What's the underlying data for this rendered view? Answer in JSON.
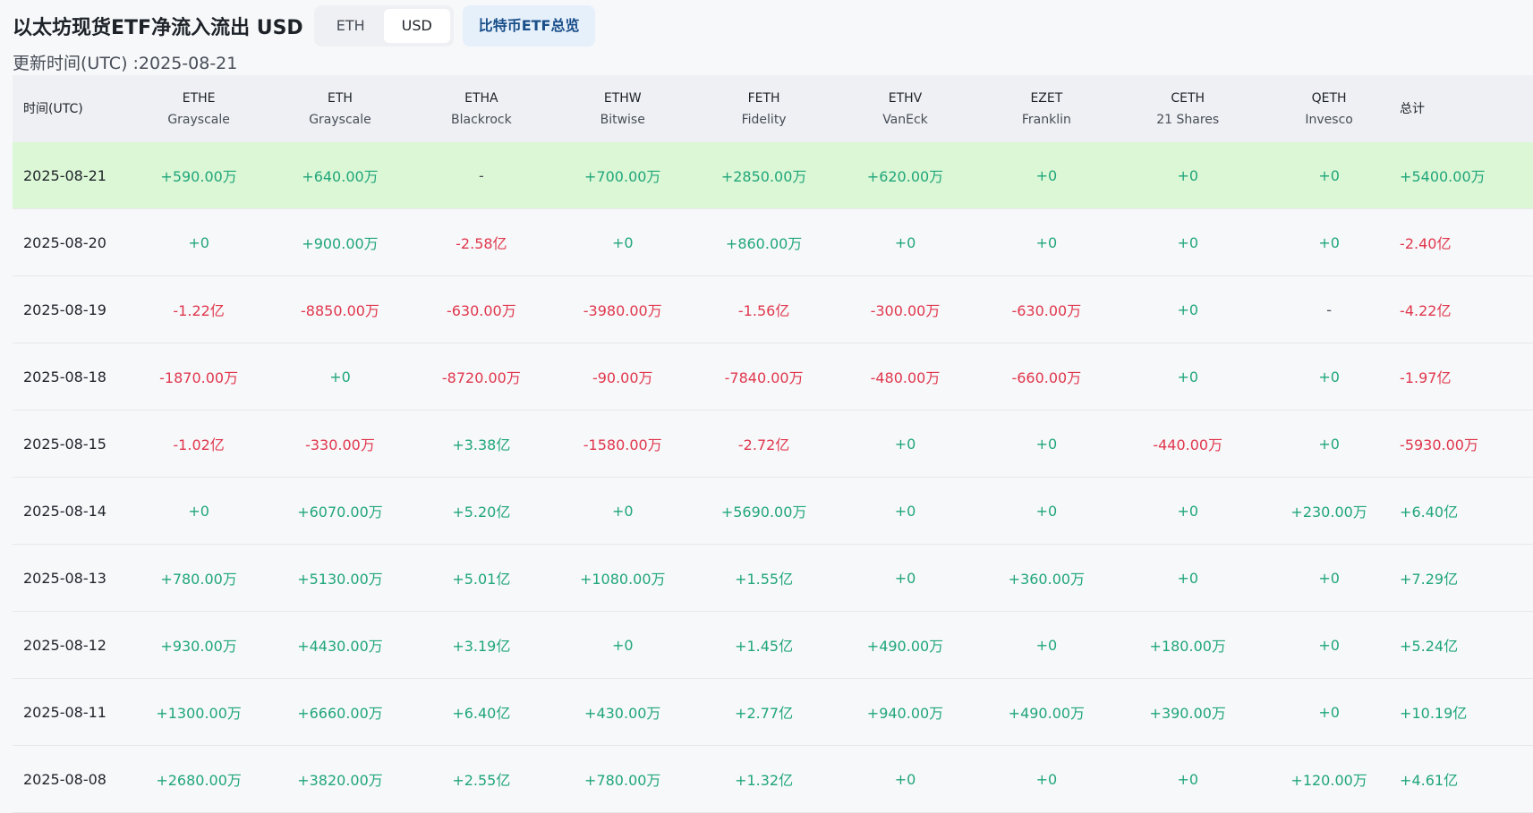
{
  "header": {
    "title": "以太坊现货ETF净流入流出 USD",
    "toggle": [
      "ETH",
      "USD"
    ],
    "toggle_active": "USD",
    "btc_overview": "比特币ETF总览"
  },
  "updated": "更新时间(UTC) :2025-08-21",
  "table": {
    "date_header": "时间(UTC)",
    "total_header": "总计",
    "etfs": [
      {
        "ticker": "ETHE",
        "issuer": "Grayscale"
      },
      {
        "ticker": "ETH",
        "issuer": "Grayscale"
      },
      {
        "ticker": "ETHA",
        "issuer": "Blackrock"
      },
      {
        "ticker": "ETHW",
        "issuer": "Bitwise"
      },
      {
        "ticker": "FETH",
        "issuer": "Fidelity"
      },
      {
        "ticker": "ETHV",
        "issuer": "VanEck"
      },
      {
        "ticker": "EZET",
        "issuer": "Franklin"
      },
      {
        "ticker": "CETH",
        "issuer": "21 Shares"
      },
      {
        "ticker": "QETH",
        "issuer": "Invesco"
      }
    ],
    "rows": [
      {
        "date": "2025-08-21",
        "values": [
          "+590.00万",
          "+640.00万",
          "-",
          "+700.00万",
          "+2850.00万",
          "+620.00万",
          "+0",
          "+0",
          "+0"
        ],
        "total": "+5400.00万"
      },
      {
        "date": "2025-08-20",
        "values": [
          "+0",
          "+900.00万",
          "-2.58亿",
          "+0",
          "+860.00万",
          "+0",
          "+0",
          "+0",
          "+0"
        ],
        "total": "-2.40亿"
      },
      {
        "date": "2025-08-19",
        "values": [
          "-1.22亿",
          "-8850.00万",
          "-630.00万",
          "-3980.00万",
          "-1.56亿",
          "-300.00万",
          "-630.00万",
          "+0",
          "-"
        ],
        "total": "-4.22亿"
      },
      {
        "date": "2025-08-18",
        "values": [
          "-1870.00万",
          "+0",
          "-8720.00万",
          "-90.00万",
          "-7840.00万",
          "-480.00万",
          "-660.00万",
          "+0",
          "+0"
        ],
        "total": "-1.97亿"
      },
      {
        "date": "2025-08-15",
        "values": [
          "-1.02亿",
          "-330.00万",
          "+3.38亿",
          "-1580.00万",
          "-2.72亿",
          "+0",
          "+0",
          "-440.00万",
          "+0"
        ],
        "total": "-5930.00万"
      },
      {
        "date": "2025-08-14",
        "values": [
          "+0",
          "+6070.00万",
          "+5.20亿",
          "+0",
          "+5690.00万",
          "+0",
          "+0",
          "+0",
          "+230.00万"
        ],
        "total": "+6.40亿"
      },
      {
        "date": "2025-08-13",
        "values": [
          "+780.00万",
          "+5130.00万",
          "+5.01亿",
          "+1080.00万",
          "+1.55亿",
          "+0",
          "+360.00万",
          "+0",
          "+0"
        ],
        "total": "+7.29亿"
      },
      {
        "date": "2025-08-12",
        "values": [
          "+930.00万",
          "+4430.00万",
          "+3.19亿",
          "+0",
          "+1.45亿",
          "+490.00万",
          "+0",
          "+180.00万",
          "+0"
        ],
        "total": "+5.24亿"
      },
      {
        "date": "2025-08-11",
        "values": [
          "+1300.00万",
          "+6660.00万",
          "+6.40亿",
          "+430.00万",
          "+2.77亿",
          "+940.00万",
          "+490.00万",
          "+390.00万",
          "+0"
        ],
        "total": "+10.19亿"
      },
      {
        "date": "2025-08-08",
        "values": [
          "+2680.00万",
          "+3820.00万",
          "+2.55亿",
          "+780.00万",
          "+1.32亿",
          "+0",
          "+0",
          "+0",
          "+120.00万"
        ],
        "total": "+4.61亿"
      }
    ]
  },
  "colors": {
    "positive": "#20a67a",
    "negative": "#e0374d",
    "latest_row_bg": "#dcf7d6"
  }
}
